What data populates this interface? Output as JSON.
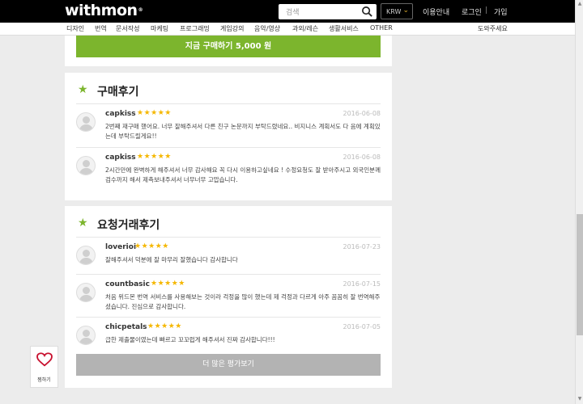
{
  "header": {
    "logo": "withmon",
    "logo_mark": "®",
    "search_placeholder": "검색",
    "currency": "KRW",
    "links": {
      "usage": "이용안내",
      "login": "로그인",
      "separator": "|",
      "signup": "가입"
    }
  },
  "categories": [
    "디자인",
    "번역",
    "문서작성",
    "마케팅",
    "프로그래밍",
    "게임강의",
    "음악/영상",
    "과외/레슨",
    "생활서비스",
    "OTHER"
  ],
  "help_link": "도와주세요",
  "buy": {
    "label": "지금 구매하기 5,000 원"
  },
  "purchase_reviews": {
    "title": "구매후기",
    "items": [
      {
        "user": "capkiss",
        "stars": "★★★★★",
        "date": "2016-06-08",
        "text": "2번째 재구매 했어요. 너무 잘해주셔서 다른 친구 논문까지 부탁드렸네요.. 비지니스 계획서도 다 음에 계획있는데 부탁드릴게요!!"
      },
      {
        "user": "capkiss",
        "stars": "★★★★★",
        "date": "2016-06-08",
        "text": "2시간만에 완벽하게 해주셔서 너무 감사해요 꼭 다시 이용하고싶네요 ! 수정요청도 잘 받아주시고 외국인분께 검수까지 해서 제측보내주셔서 너무너무 고맙습니다."
      }
    ]
  },
  "request_reviews": {
    "title": "요청거래후기",
    "items": [
      {
        "user": "loverioi",
        "stars": "★★★★★",
        "date": "2016-07-23",
        "text": "잘해주셔서 덕분에 잘 마무리 잘했습니다 감사합니다"
      },
      {
        "user": "countbasic",
        "stars": "★★★★★",
        "date": "2016-07-15",
        "text": "처음 위드몬 번역 서비스를 사용해보는 것이라 걱정을 많이 했는데 제 걱정과 다르게 아주 꼼꼼히 잘 번역해주셨습니다. 진심으로 감사합니다."
      },
      {
        "user": "chicpetals",
        "stars": "★★★★★",
        "date": "2016-07-05",
        "text": "급한 제출물이였는데 빠르고 꼬꼬럽게 해주셔서 진짜 감사합니다!!!"
      }
    ],
    "more_label": "더 많은 평가보기"
  },
  "like": {
    "label": "찜하기"
  },
  "colors": {
    "accent_green": "#7cb52d",
    "star_yellow": "#f5b700",
    "header_black": "#000000"
  }
}
